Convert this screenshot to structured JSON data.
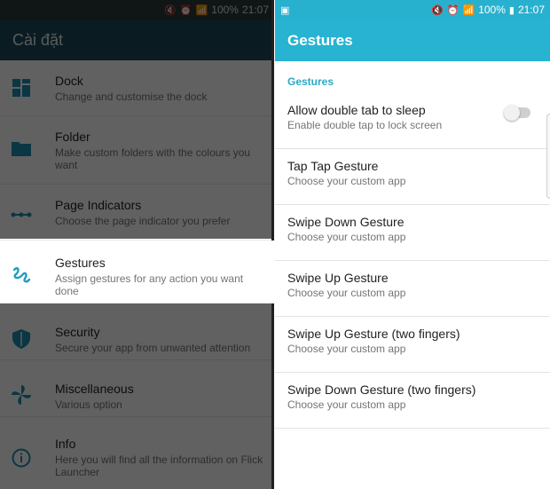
{
  "left": {
    "status": {
      "battery": "100%",
      "time": "21:07"
    },
    "title": "Cài đặt",
    "items": [
      {
        "title": "Dock",
        "subtitle": "Change and customise the dock",
        "icon": "dock-icon"
      },
      {
        "title": "Folder",
        "subtitle": "Make custom folders with the colours you want",
        "icon": "folder-icon"
      },
      {
        "title": "Page Indicators",
        "subtitle": "Choose the page indicator you prefer",
        "icon": "page-indicator-icon"
      },
      {
        "title": "Gestures",
        "subtitle": "Assign gestures for any action you want done",
        "icon": "gesture-icon"
      },
      {
        "title": "Security",
        "subtitle": "Secure your app from unwanted attention",
        "icon": "shield-icon"
      },
      {
        "title": "Miscellaneous",
        "subtitle": "Various option",
        "icon": "pinwheel-icon"
      },
      {
        "title": "Info",
        "subtitle": "Here you will find all the information on Flick Launcher",
        "icon": "info-icon"
      }
    ]
  },
  "right": {
    "status": {
      "battery": "100%",
      "time": "21:07"
    },
    "title": "Gestures",
    "section": "Gestures",
    "items": [
      {
        "title": "Allow double tab to sleep",
        "subtitle": "Enable double tap to lock screen",
        "toggle": false
      },
      {
        "title": "Tap Tap Gesture",
        "subtitle": "Choose your custom app"
      },
      {
        "title": "Swipe Down Gesture",
        "subtitle": "Choose your custom app"
      },
      {
        "title": "Swipe Up Gesture",
        "subtitle": "Choose your custom app"
      },
      {
        "title": "Swipe Up Gesture (two fingers)",
        "subtitle": "Choose your custom app"
      },
      {
        "title": "Swipe Down Gesture (two fingers)",
        "subtitle": "Choose your custom app"
      }
    ]
  },
  "colors": {
    "accent": "#27b3d1",
    "left_appbar": "#1c4b58"
  }
}
